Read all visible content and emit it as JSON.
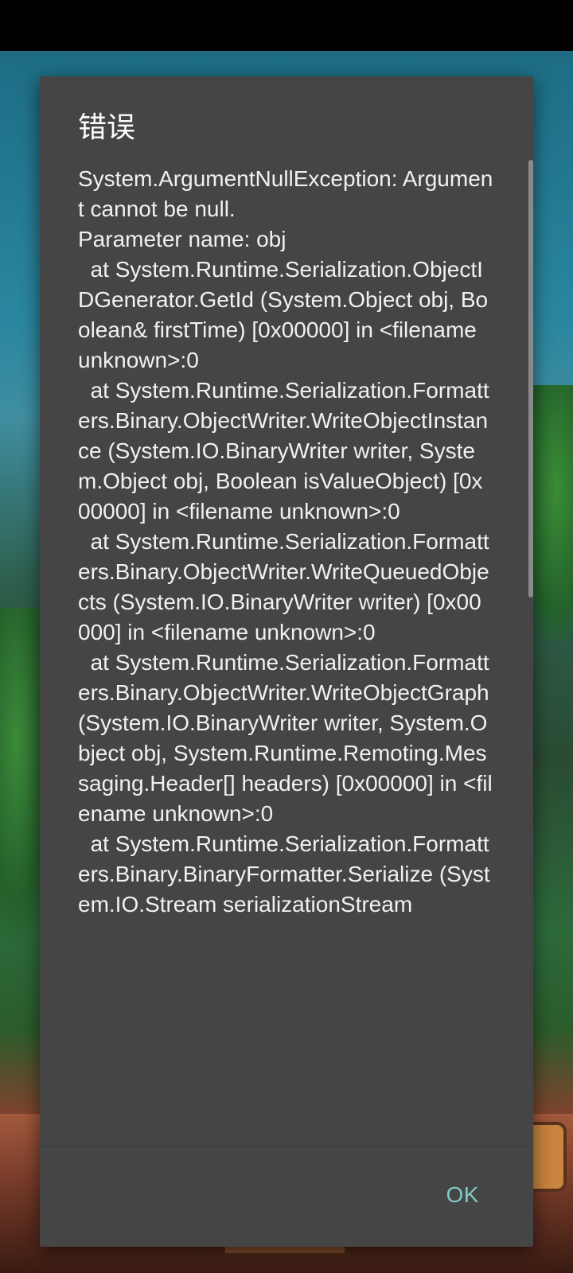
{
  "dialog": {
    "title": "错误",
    "message": "System.ArgumentNullException: Argument cannot be null.\nParameter name: obj\n  at System.Runtime.Serialization.ObjectIDGenerator.GetId (System.Object obj, Boolean& firstTime) [0x00000] in <filename unknown>:0\n  at System.Runtime.Serialization.Formatters.Binary.ObjectWriter.WriteObjectInstance (System.IO.BinaryWriter writer, System.Object obj, Boolean isValueObject) [0x00000] in <filename unknown>:0\n  at System.Runtime.Serialization.Formatters.Binary.ObjectWriter.WriteQueuedObjects (System.IO.BinaryWriter writer) [0x00000] in <filename unknown>:0\n  at System.Runtime.Serialization.Formatters.Binary.ObjectWriter.WriteObjectGraph (System.IO.BinaryWriter writer, System.Object obj, System.Runtime.Remoting.Messaging.Header[] headers) [0x00000] in <filename unknown>:0\n  at System.Runtime.Serialization.Formatters.Binary.BinaryFormatter.Serialize (System.IO.Stream serializationStream",
    "ok_label": "OK"
  },
  "colors": {
    "dialog_background": "#454545",
    "accent": "#80cbc4",
    "text": "#f1f1f1"
  }
}
